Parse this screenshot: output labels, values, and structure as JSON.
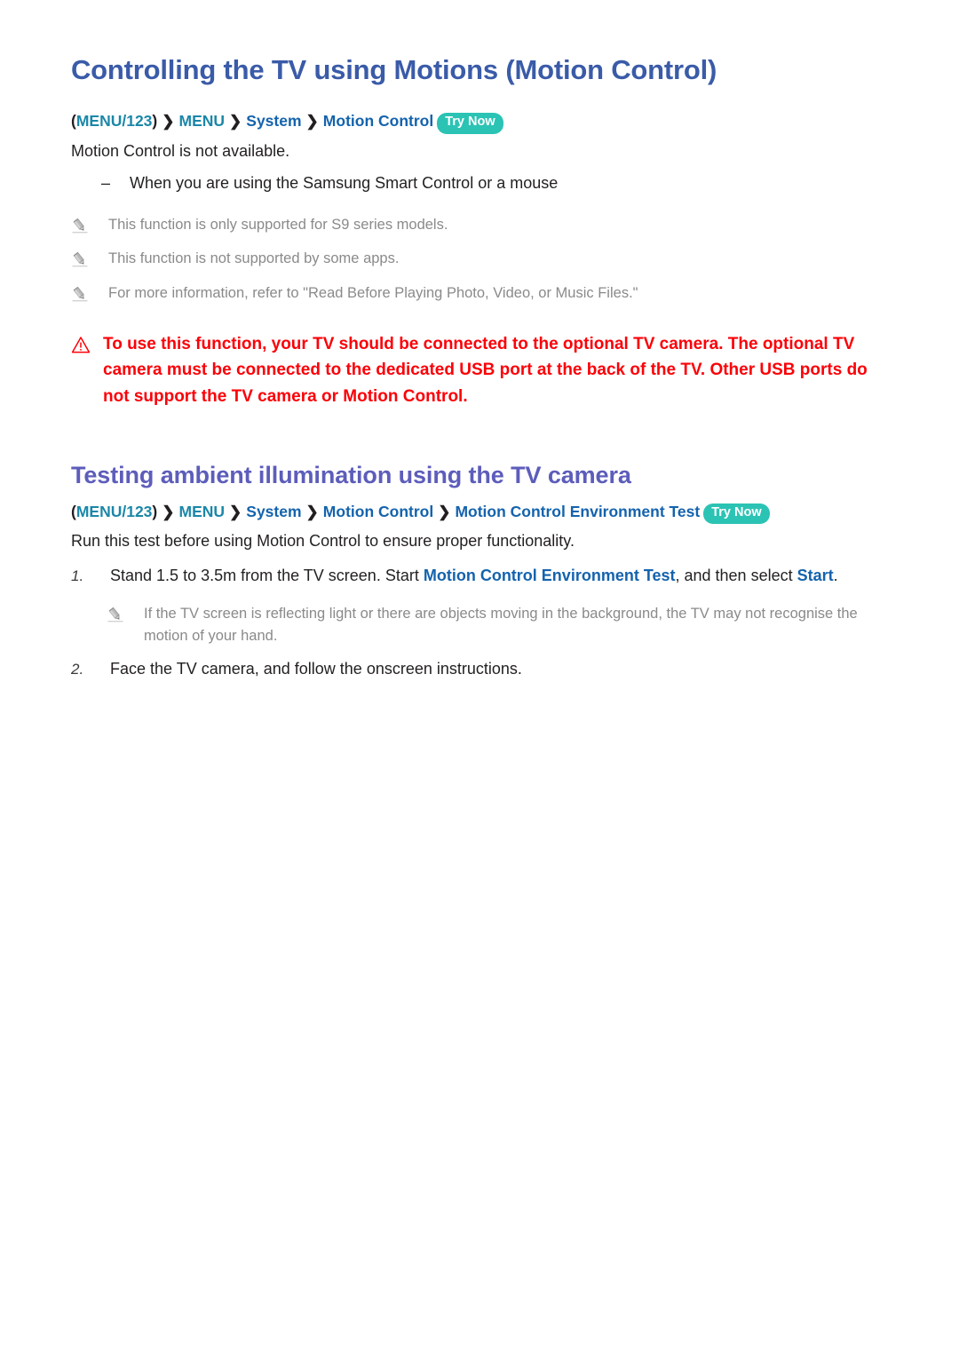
{
  "colors": {
    "title_blue": "#3a5ba8",
    "section_purple": "#5d5dbb",
    "breadcrumb_teal": "#1b87a8",
    "breadcrumb_blue": "#1463ad",
    "badge_teal": "#2bc3b4",
    "warning_red": "#fb0007",
    "note_gray": "#8a8a8a",
    "body_black": "#231f20"
  },
  "section1": {
    "title": "Controlling the TV using Motions (Motion Control)",
    "breadcrumb": {
      "open_paren": "(",
      "menu123": "MENU/123",
      "close_paren": ")",
      "separator": "❯",
      "menu": "MENU",
      "system": "System",
      "motion_control": "Motion Control",
      "badge": "Try Now"
    },
    "intro": "Motion Control is not available.",
    "dash_items": [
      {
        "mark": "–",
        "text": "When you are using the Samsung Smart Control or a mouse"
      }
    ],
    "notes": [
      {
        "icon": "pencil-icon",
        "text": "This function is only supported for S9 series models."
      },
      {
        "icon": "pencil-icon",
        "text": "This function is not supported by some apps."
      },
      {
        "icon": "pencil-icon",
        "text": "For more information, refer to \"Read Before Playing Photo, Video, or Music Files.\""
      }
    ],
    "warning": {
      "icon": "warning-triangle-icon",
      "text": "To use this function, your TV should be connected to the optional TV camera. The optional TV camera must be connected to the dedicated USB port at the back of the TV. Other USB ports do not support the TV camera or Motion Control."
    }
  },
  "section2": {
    "title": "Testing ambient illumination using the TV camera",
    "breadcrumb": {
      "open_paren": "(",
      "menu123": "MENU/123",
      "close_paren": ")",
      "separator": "❯",
      "menu": "MENU",
      "system": "System",
      "motion_control": "Motion Control",
      "environment_test": "Motion Control Environment Test",
      "badge": "Try Now"
    },
    "intro": "Run this test before using Motion Control to ensure proper functionality.",
    "steps": [
      {
        "number": "1.",
        "text_part1": "Stand 1.5 to 3.5m from the TV screen. Start ",
        "highlight1": "Motion Control Environment Test",
        "text_part2": ", and then select ",
        "highlight2": "Start",
        "text_part3": "."
      },
      {
        "number": "2.",
        "text_part1": "Face the TV camera, and follow the onscreen instructions.",
        "highlight1": "",
        "text_part2": "",
        "highlight2": "",
        "text_part3": ""
      }
    ],
    "step_note": {
      "icon": "pencil-icon",
      "text": "If the TV screen is reflecting light or there are objects moving in the background, the TV may not recognise the motion of your hand."
    }
  }
}
